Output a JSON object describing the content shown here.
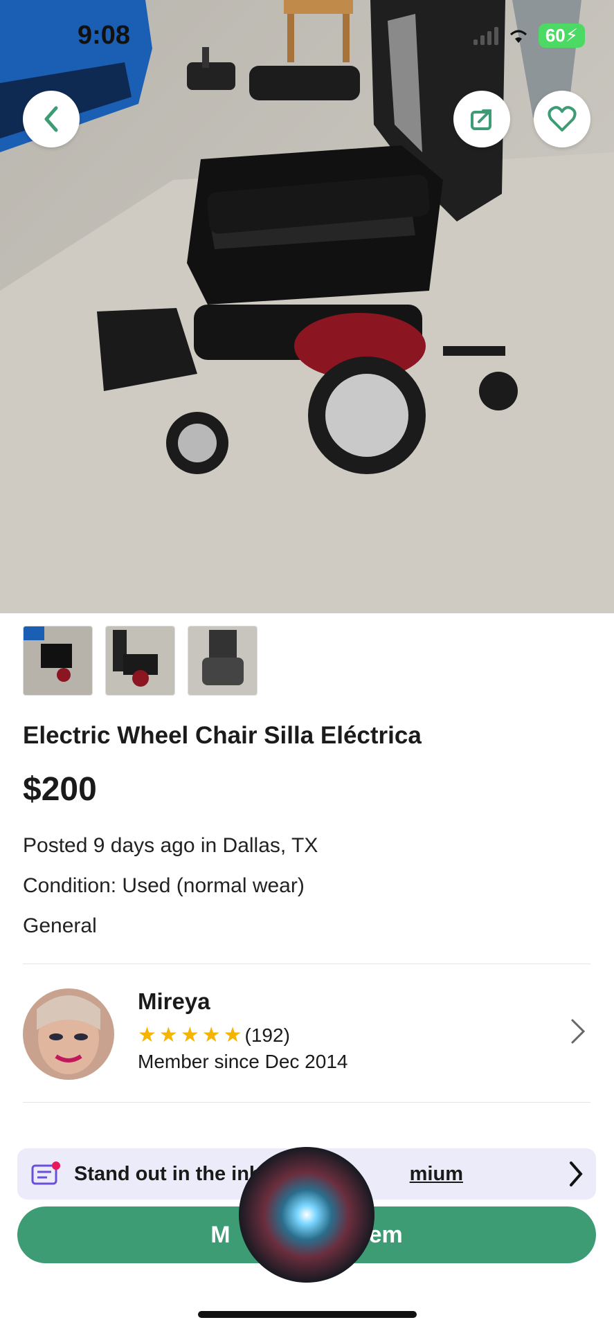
{
  "status": {
    "time": "9:08",
    "battery": "60"
  },
  "listing": {
    "title": "Electric Wheel Chair  Silla Eléctrica",
    "price": "$200",
    "posted": "Posted 9 days ago in Dallas, TX",
    "condition": "Condition: Used (normal wear)",
    "category": "General"
  },
  "seller": {
    "name": "Mireya",
    "rating_count": "(192)",
    "stars": 5,
    "member_since": "Member since Dec 2014"
  },
  "promo": {
    "text_start": "Stand out in the inb",
    "text_link": "mium"
  },
  "cta": {
    "label_start": "M",
    "label_end": "em"
  },
  "icons": {
    "back": "chevron-left-icon",
    "share": "share-icon",
    "favorite": "heart-icon",
    "seller_chevron": "chevron-right-icon",
    "promo": "message-icon"
  },
  "colors": {
    "accent": "#3e9c74",
    "promo_bg": "#ecebf9",
    "star": "#f4b400"
  }
}
